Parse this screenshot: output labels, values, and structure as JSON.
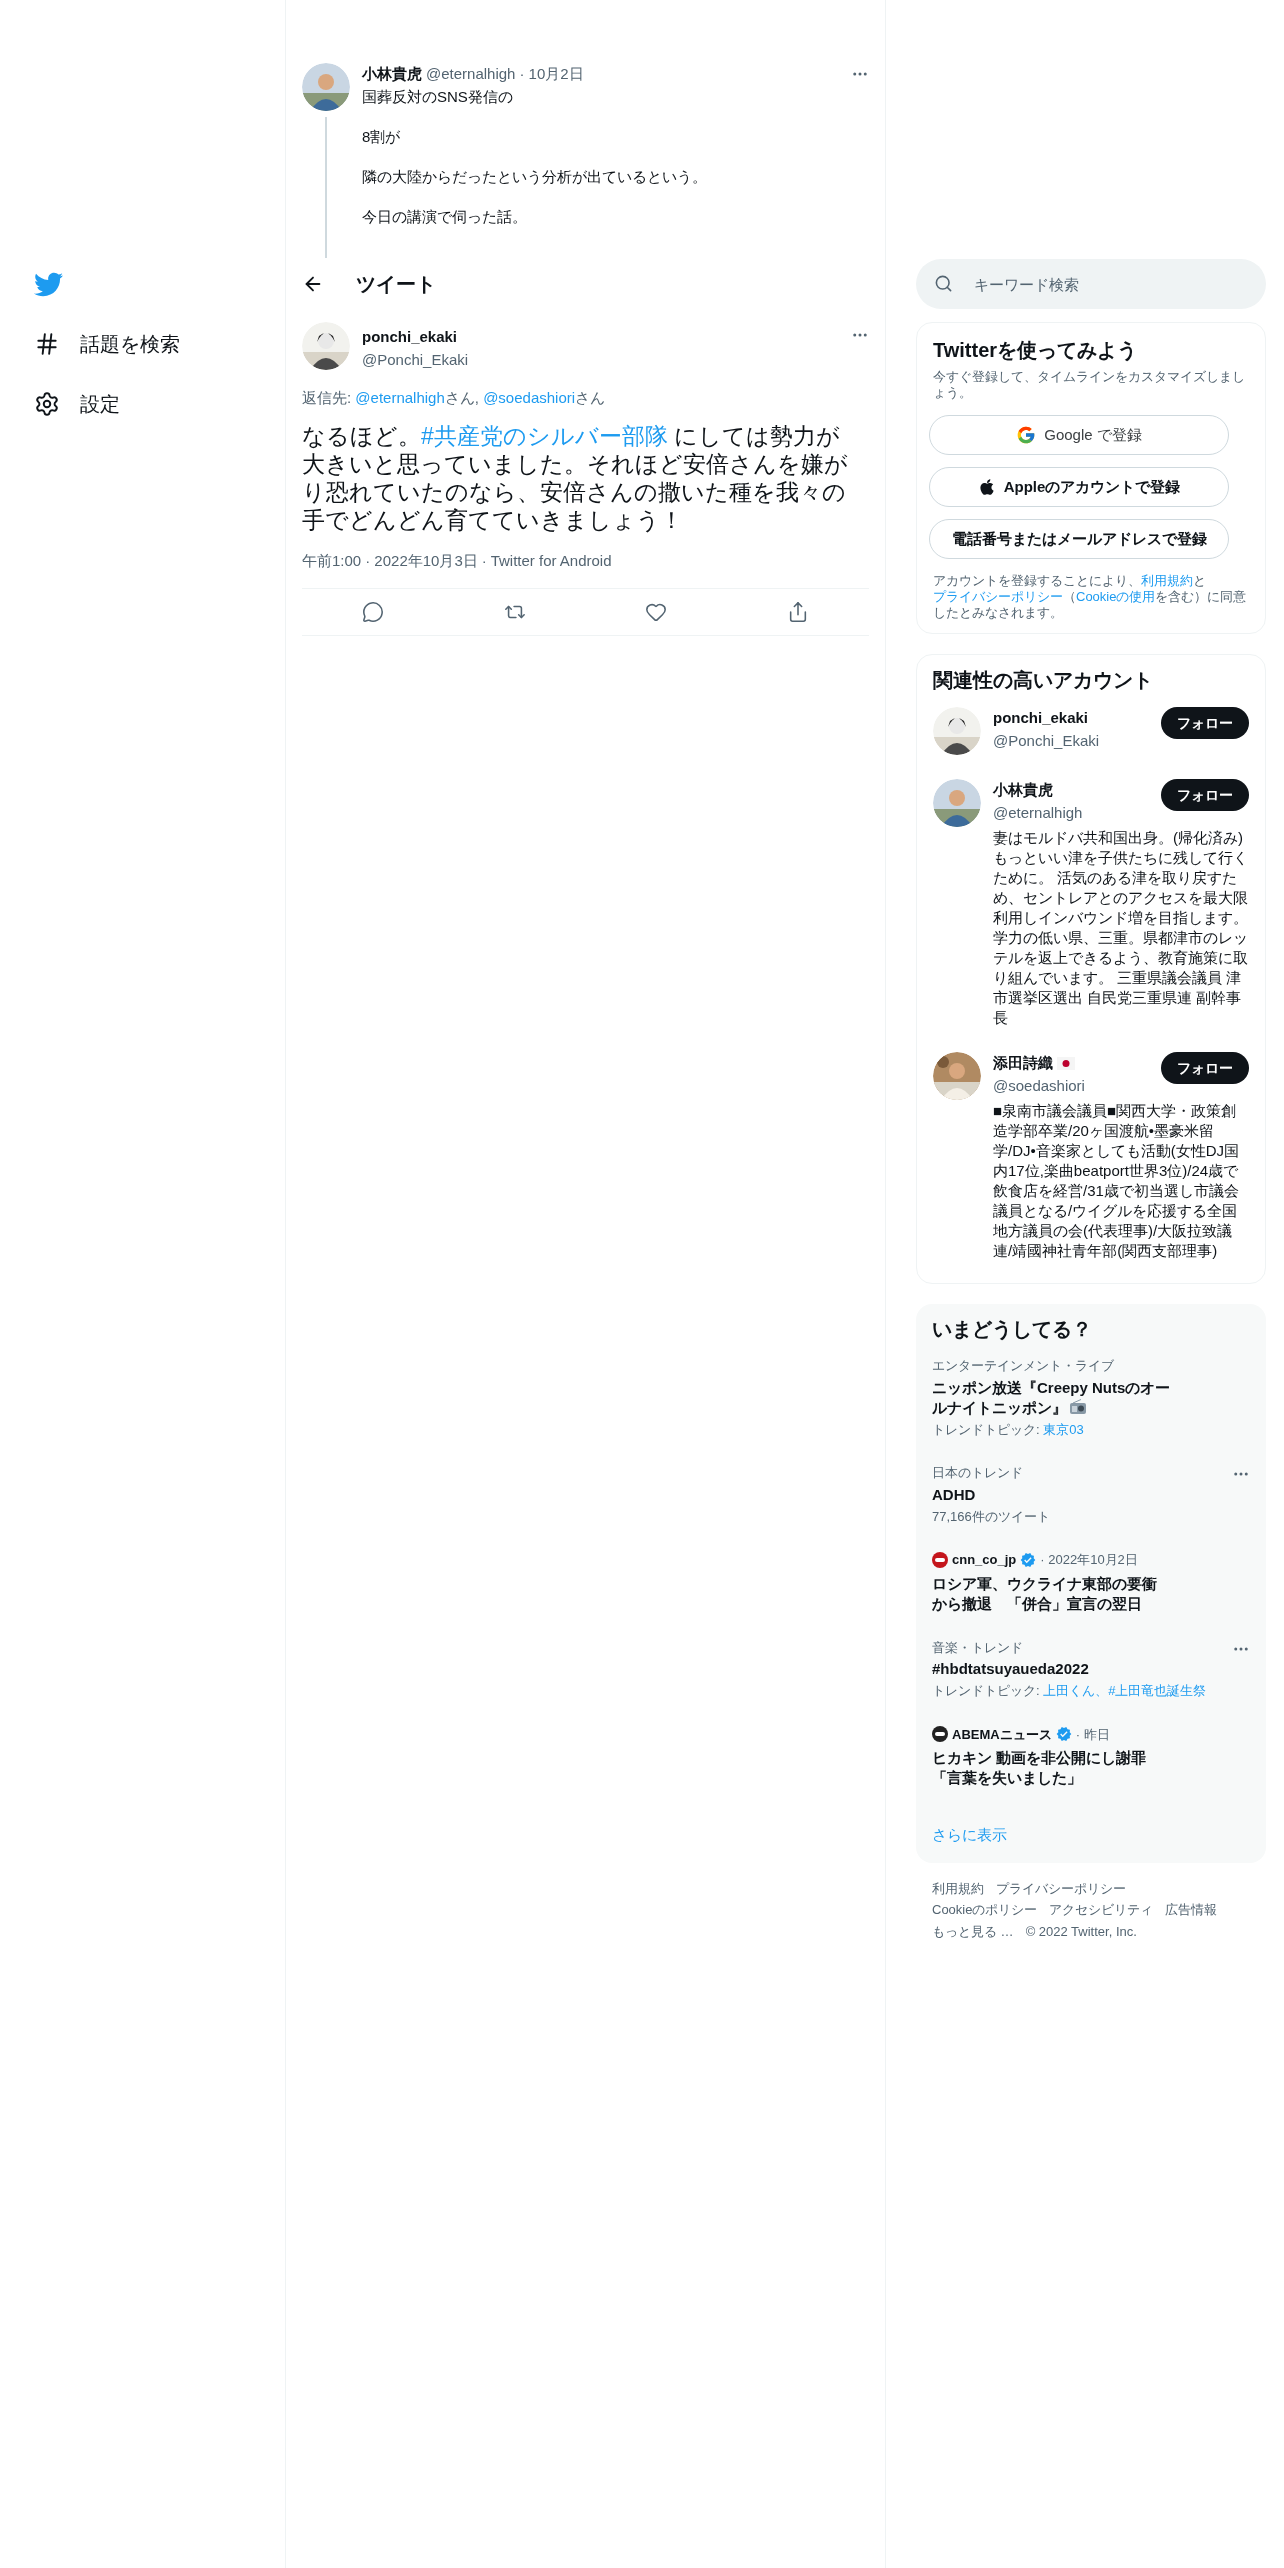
{
  "sidebar": {
    "items": [
      {
        "kind": "explore",
        "label": "話題を検索"
      },
      {
        "kind": "settings",
        "label": "設定"
      }
    ]
  },
  "parent_tweet": {
    "name": "小林貴虎",
    "handle": "@eternalhigh",
    "date": "· 10月2日",
    "paragraphs": [
      "国葬反対のSNS発信の",
      "8割が",
      "隣の大陸からだったという分析が出ているという。",
      "今日の講演で伺った話。"
    ]
  },
  "header": {
    "title": "ツイート"
  },
  "tweet": {
    "name": "ponchi_ekaki",
    "handle": "@Ponchi_Ekaki",
    "reply_to": [
      {
        "kind": "plain",
        "text": "返信先: "
      },
      {
        "kind": "link",
        "text": "@eternalhigh"
      },
      {
        "kind": "plain",
        "text": "さん, "
      },
      {
        "kind": "link",
        "text": "@soedashiori"
      },
      {
        "kind": "plain",
        "text": "さん"
      }
    ],
    "text": [
      {
        "kind": "plain",
        "text": "なるほど。"
      },
      {
        "kind": "link",
        "text": "#共産党のシルバー部隊"
      },
      {
        "kind": "plain",
        "text": " にしては勢力が大きいと思っていました。それほど安倍さんを嫌がり恐れていたのなら、安倍さんの撒いた種を我々の手でどんどん育てていきましょう！"
      }
    ],
    "meta": [
      "午前1:00",
      "· 2022年10月3日",
      "· Twitter for Android"
    ],
    "actions": [
      {
        "kind": "reply"
      },
      {
        "kind": "retweet"
      },
      {
        "kind": "like"
      },
      {
        "kind": "share"
      }
    ]
  },
  "search": {
    "placeholder": "キーワード検索"
  },
  "signup": {
    "title": "Twitterを使ってみよう",
    "subtitle": "今すぐ登録して、タイムラインをカスタマイズしましょう。",
    "buttons": [
      {
        "kind": "google",
        "label": "Google で登録"
      },
      {
        "kind": "apple",
        "label": "Appleのアカウントで登録"
      },
      {
        "kind": "phone",
        "label": "電話番号またはメールアドレスで登録"
      }
    ],
    "notice": [
      {
        "kind": "plain",
        "text": "アカウントを登録することにより、"
      },
      {
        "kind": "link",
        "text": "利用規約"
      },
      {
        "kind": "plain",
        "text": "と"
      },
      {
        "kind": "link",
        "text": "プライバシーポリシー"
      },
      {
        "kind": "plain",
        "text": "（"
      },
      {
        "kind": "link",
        "text": "Cookieの使用"
      },
      {
        "kind": "plain",
        "text": "を含む）に同意したとみなされます。"
      }
    ]
  },
  "accounts": {
    "title": "関連性の高いアカウント",
    "items": [
      {
        "name": "ponchi_ekaki",
        "handle": "@Ponchi_Ekaki",
        "flag": false,
        "button": "フォロー"
      },
      {
        "name": "小林貴虎",
        "handle": "@eternalhigh",
        "flag": false,
        "button": "フォロー",
        "bio": "妻はモルドバ共和国出身。(帰化済み) もっといい津を子供たちに残して行くために。 活気のある津を取り戻すため、セントレアとのアクセスを最大限利用しインバウンド増を目指します。学力の低い県、三重。県都津市のレッテルを返上できるよう、教育施策に取り組んでいます。 三重県議会議員 津市選挙区選出 自民党三重県連 副幹事長"
      },
      {
        "name": "添田詩織",
        "handle": "@soedashiori",
        "flag": true,
        "button": "フォロー",
        "bio": "■泉南市議会議員■関西大学・政策創造学部卒業/20ヶ国渡航•墨豪米留学/DJ•音楽家としても活動(女性DJ国内17位,楽曲beatport世界3位)/24歳で飲食店を経営/31歳で初当選し市議会議員となる/ウイグルを応援する全国地方議員の会(代表理事)/大阪拉致議連/靖國神社青年部(関西支部理事)"
      }
    ]
  },
  "trends": {
    "title": "いまどうしてる？",
    "items": [
      {
        "kind": "trend",
        "context": "エンターテインメント・ライブ",
        "title": "ニッポン放送『Creepy Nutsのオールナイトニッポン』",
        "radio": true,
        "menu": false,
        "topic_label": "トレンドトピック: ",
        "topics": "東京03"
      },
      {
        "kind": "trend",
        "context": "日本のトレンド",
        "title": "ADHD",
        "radio": false,
        "menu": true,
        "count": "77,166件のツイート"
      },
      {
        "kind": "news",
        "source": "cnn_co_jp",
        "color": "#c4161c",
        "verified": true,
        "time": "· 2022年10月2日",
        "title": "ロシア軍、ウクライナ東部の要衝から撤退　「併合」宣言の翌日"
      },
      {
        "kind": "trend",
        "context": "音楽・トレンド",
        "title": "#hbdtatsuyaueda2022",
        "radio": false,
        "menu": true,
        "topic_label": "トレンドトピック: ",
        "topics": "上田くん、#上田竜也誕生祭"
      },
      {
        "kind": "news",
        "source": "ABEMAニュース",
        "color": "#222222",
        "verified": true,
        "time": "· 昨日",
        "title": "ヒカキン 動画を非公開にし謝罪「言葉を失いました」"
      }
    ],
    "more": "さらに表示"
  },
  "footer": {
    "links": [
      "利用規約",
      "プライバシーポリシー",
      "Cookieのポリシー",
      "アクセシビリティ",
      "広告情報",
      "もっと見る …",
      "© 2022 Twitter, Inc."
    ]
  }
}
